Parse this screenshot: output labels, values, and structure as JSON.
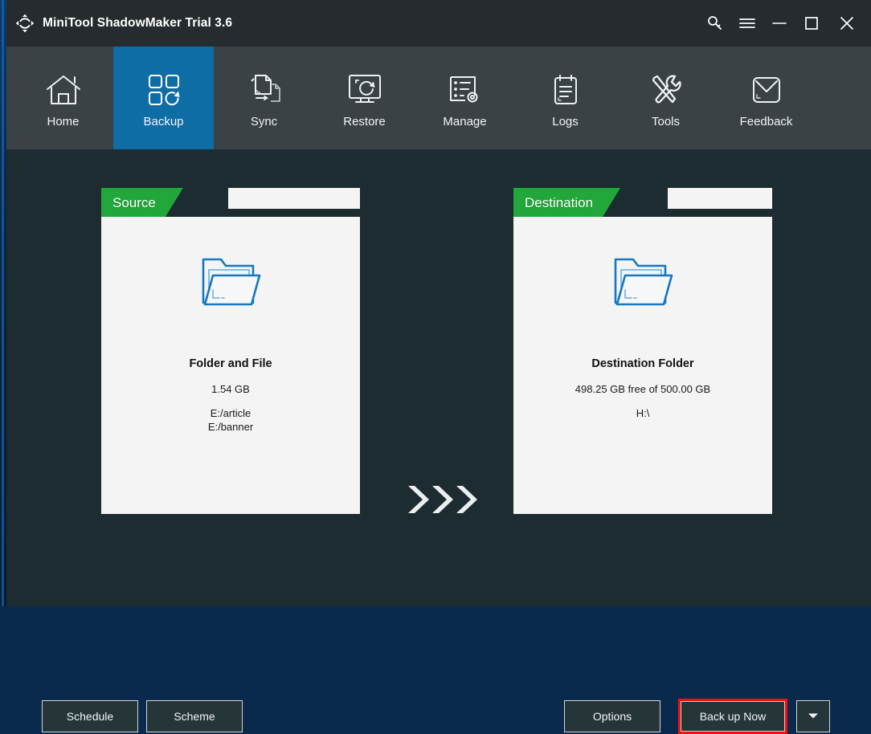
{
  "window": {
    "title": "MiniTool ShadowMaker Trial 3.6",
    "logo_icon": "sync-arrows-logo-icon",
    "controls": [
      {
        "name": "search-key-icon",
        "label": "Search"
      },
      {
        "name": "hamburger-menu-icon",
        "label": "Menu"
      },
      {
        "name": "minimize-icon",
        "label": "Minimize"
      },
      {
        "name": "maximize-icon",
        "label": "Maximize"
      },
      {
        "name": "close-icon",
        "label": "Close"
      }
    ]
  },
  "nav": {
    "active": "Backup",
    "active_color": "#0f6da5",
    "items": [
      {
        "label": "Home",
        "icon": "home-icon"
      },
      {
        "label": "Backup",
        "icon": "backup-squares-icon"
      },
      {
        "label": "Sync",
        "icon": "sync-files-icon"
      },
      {
        "label": "Restore",
        "icon": "restore-monitor-icon"
      },
      {
        "label": "Manage",
        "icon": "manage-list-gear-icon"
      },
      {
        "label": "Logs",
        "icon": "logs-clipboard-icon"
      },
      {
        "label": "Tools",
        "icon": "tools-wrench-screwdriver-icon"
      },
      {
        "label": "Feedback",
        "icon": "feedback-envelope-icon"
      }
    ]
  },
  "source_panel": {
    "tab_label": "Source",
    "tab_color": "#22a73a",
    "folder_icon": "blue-folder-icon",
    "title": "Folder and File",
    "size": "1.54 GB",
    "paths": [
      "E:/article",
      "E:/banner"
    ]
  },
  "transfer": {
    "arrows_icon": "triple-chevron-right-icon",
    "count": 3
  },
  "destination_panel": {
    "tab_label": "Destination",
    "tab_color": "#22a73a",
    "folder_icon": "blue-folder-icon",
    "title": "Destination Folder",
    "free_space": "498.25 GB free of 500.00 GB",
    "drive": "H:\\"
  },
  "footer": {
    "schedule_label": "Schedule",
    "scheme_label": "Scheme",
    "options_label": "Options",
    "backup_now_label": "Back up Now",
    "backup_now_highlight_color": "#fb0b0b",
    "dropdown_icon": "chevron-down-icon"
  }
}
